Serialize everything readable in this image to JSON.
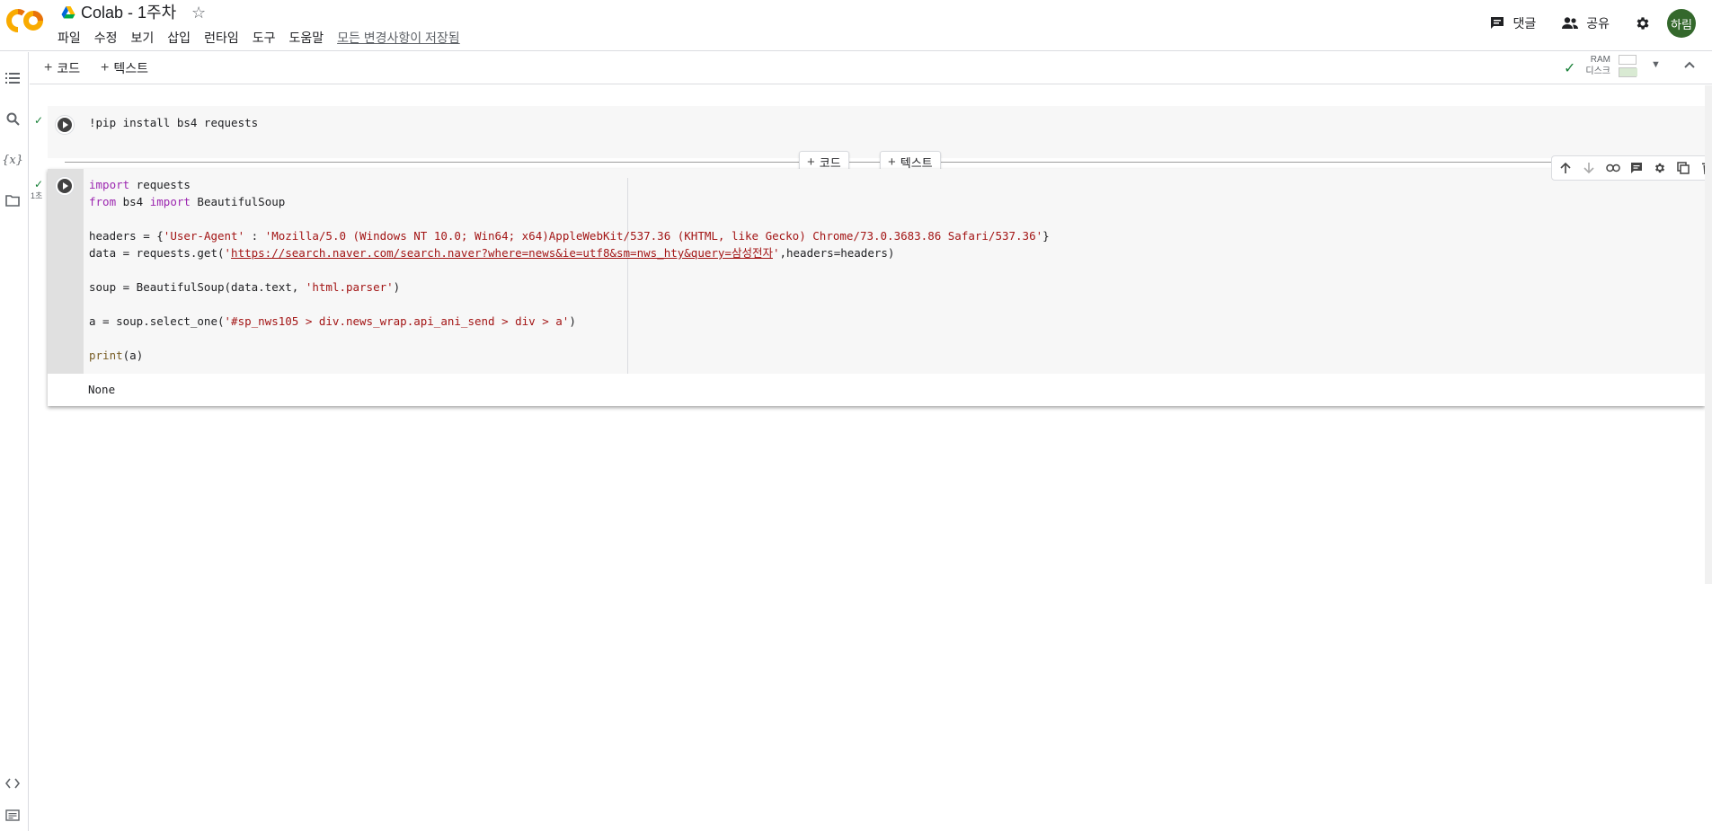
{
  "header": {
    "doc_title": "Colab - 1주차",
    "menu": [
      "파일",
      "수정",
      "보기",
      "삽입",
      "런타임",
      "도구",
      "도움말"
    ],
    "saved_status": "모든 변경사항이 저장됨",
    "comments_label": "댓글",
    "share_label": "공유",
    "avatar_text": "하림"
  },
  "toolbar": {
    "add_code": "코드",
    "add_text": "텍스트",
    "ram_label": "RAM",
    "disk_label": "디스크"
  },
  "insert_bar": {
    "add_code": "코드",
    "add_text": "텍스트"
  },
  "cells": [
    {
      "lines": [
        "!pip install bs4 requests"
      ]
    },
    {
      "exec_time": "1초",
      "lines": [
        "import requests",
        "from bs4 import BeautifulSoup",
        "",
        "headers = {'User-Agent' : 'Mozilla/5.0 (Windows NT 10.0; Win64; x64)AppleWebKit/537.36 (KHTML, like Gecko) Chrome/73.0.3683.86 Safari/537.36'}",
        "data = requests.get('https://search.naver.com/search.naver?where=news&ie=utf8&sm=nws_hty&query=삼성전자',headers=headers)",
        "",
        "soup = BeautifulSoup(data.text, 'html.parser')",
        "",
        "a = soup.select_one('#sp_nws105 > div.news_wrap.api_ani_send > div > a')",
        "",
        "print(a)"
      ],
      "output": "None"
    }
  ],
  "code_tokens": {
    "kw_import": "import",
    "kw_from": "from",
    "bi_print": "print",
    "c2l1_rest": " requests",
    "c2l2_mid": " bs4 ",
    "c2l2_rest": " BeautifulSoup",
    "c2l4_pre": "headers = {",
    "c2l4_str1": "'User-Agent'",
    "c2l4_mid": " : ",
    "c2l4_str2": "'Mozilla/5.0 (Windows NT 10.0; Win64; x64)AppleWebKit/537.36 (KHTML, like Gecko) Chrome/73.0.3683.86 Safari/537.36'",
    "c2l4_post": "}",
    "c2l5_pre": "data = requests.get(",
    "c2l5_q1": "'",
    "c2l5_url": "https://search.naver.com/search.naver?where=news&ie=utf8&sm=nws_hty&query=삼성전자",
    "c2l5_q2": "'",
    "c2l5_post": ",headers=headers)",
    "c2l7_pre": "soup = BeautifulSoup(data.text, ",
    "c2l7_str": "'html.parser'",
    "c2l7_post": ")",
    "c2l9_pre": "a = soup.select_one(",
    "c2l9_str": "'#sp_nws105 > div.news_wrap.api_ani_send > div > a'",
    "c2l9_post": ")",
    "c2l11_post": "(a)"
  },
  "colors": {
    "keyword": "#9c27b0",
    "string": "#a31515",
    "run_success": "#188038",
    "avatar_bg": "#34682c"
  },
  "icons": [
    "colab-logo",
    "drive-icon",
    "star-icon",
    "comment-icon",
    "people-icon",
    "gear-icon",
    "toc-icon",
    "search-icon",
    "variables-icon",
    "folder-icon",
    "code-snippets-icon",
    "terminal-icon"
  ]
}
